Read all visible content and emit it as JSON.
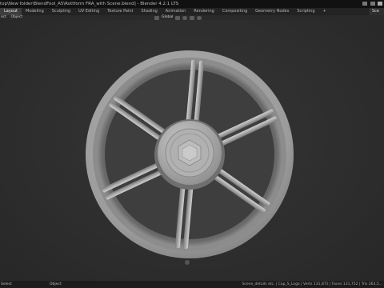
{
  "window": {
    "title": "top\\New folder\\BlendFool_A5\\Rottform FRA_with Scene.blend] - Blender 4.2.1 LTS"
  },
  "workspace": {
    "tabs": [
      "Layout",
      "Modeling",
      "Sculpting",
      "UV Editing",
      "Texture Paint",
      "Shading",
      "Animation",
      "Rendering",
      "Compositing",
      "Geometry Nodes",
      "Scripting"
    ],
    "active_tab": "Layout",
    "add_tab_label": "+",
    "scene_label": "Sce"
  },
  "viewport_header": {
    "menu_items": [
      "ect",
      "Object"
    ],
    "orientation_label": "Global"
  },
  "statusbar": {
    "left_hint": "Select",
    "middle_hint": "Object",
    "stats": "Scene_details etc. | Cap_S_Logo | Verts 131,871 | Faces 131,752 | Tris 263,5..."
  },
  "colors": {
    "wheel_base": "#9a9a9a",
    "wheel_highlight": "#c4c4c4",
    "wheel_shadow": "#555555",
    "viewport_bg": "#303030",
    "active_tab_bg": "#3d3d3d"
  }
}
